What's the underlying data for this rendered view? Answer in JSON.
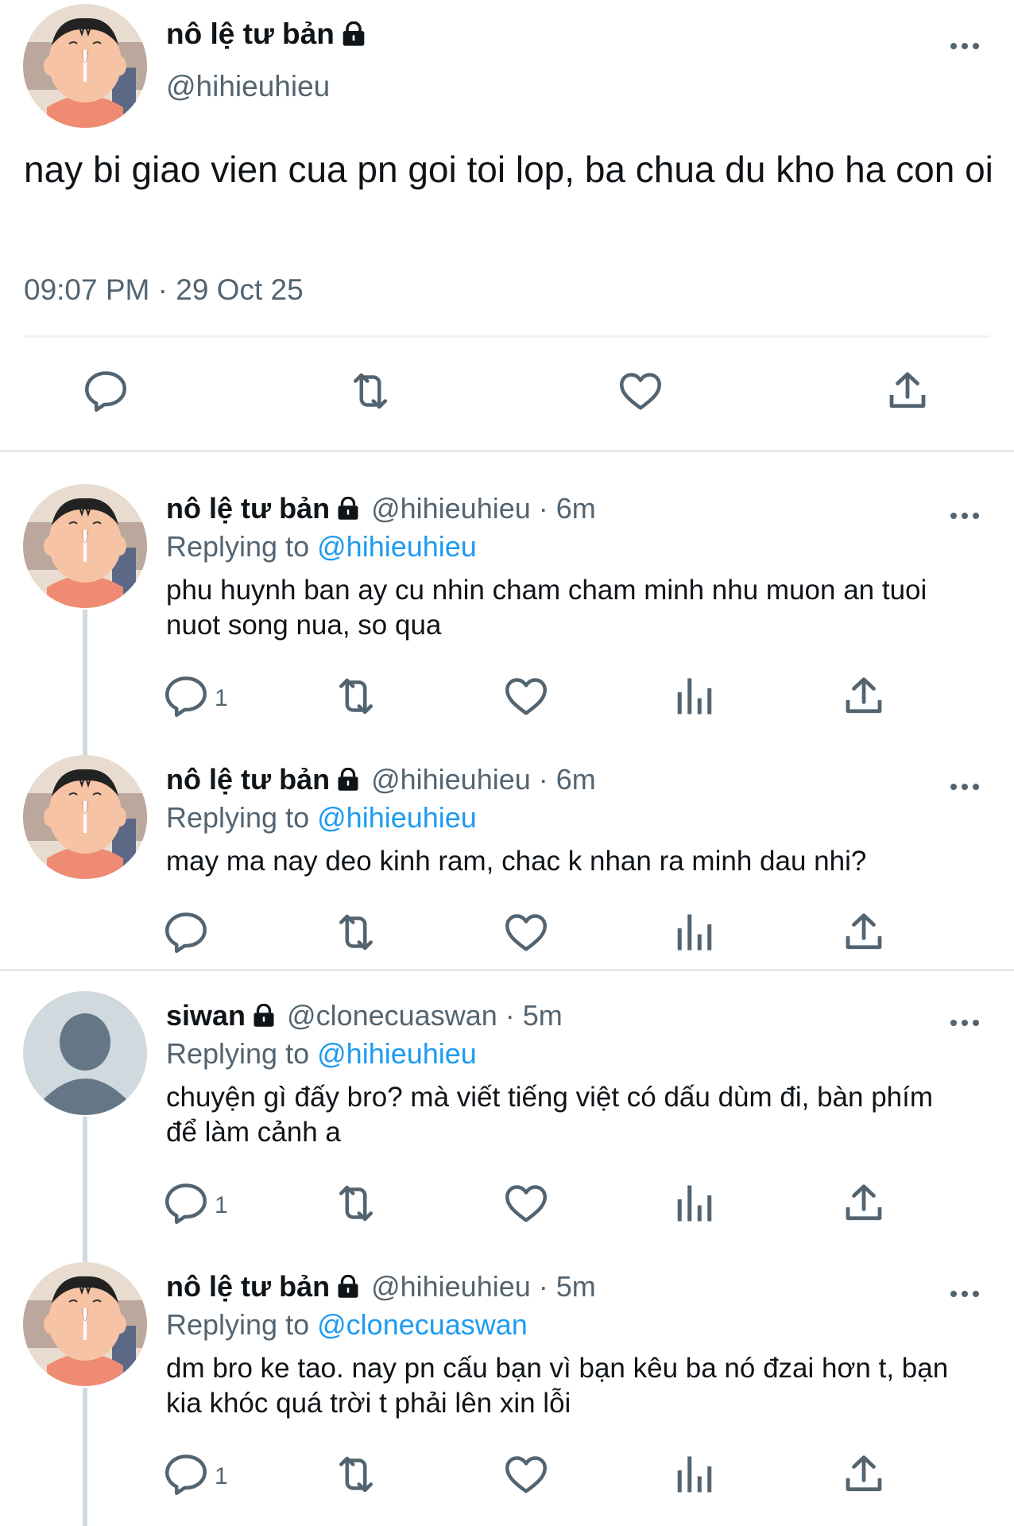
{
  "main": {
    "name": "nô lệ tư bản",
    "handle": "@hihieuhieu",
    "text": "nay bi giao vien cua pn goi toi lop, ba chua du kho ha con oi",
    "timestamp": "09:07 PM · 29 Oct 25"
  },
  "replies": [
    {
      "name": "nô lệ tư bản",
      "meta": "@hihieuhieu · 6m",
      "replying_prefix": "Replying to",
      "replying_to": "@hihieuhieu",
      "text": "phu huynh ban ay cu nhin cham cham minh nhu muon an tuoi nuot song nua, so qua",
      "reply_count": "1",
      "avatar": "cartoon"
    },
    {
      "name": "nô lệ tư bản",
      "meta": "@hihieuhieu · 6m",
      "replying_prefix": "Replying to",
      "replying_to": "@hihieuhieu",
      "text": "may ma nay deo kinh ram, chac k nhan ra minh dau nhi?",
      "reply_count": "",
      "avatar": "cartoon"
    },
    {
      "name": "siwan",
      "meta": "@clonecuaswan · 5m",
      "replying_prefix": "Replying to",
      "replying_to": "@hihieuhieu",
      "text": "chuyện gì đấy bro? mà viết tiếng việt có dấu dùm đi, bàn phím để làm cảnh a",
      "reply_count": "1",
      "avatar": "default"
    },
    {
      "name": "nô lệ tư bản",
      "meta": "@hihieuhieu · 5m",
      "replying_prefix": "Replying to",
      "replying_to": "@clonecuaswan",
      "text": "dm bro ke tao. nay pn cấu bạn vì bạn kêu ba nó đzai hơn t, bạn kia khóc quá trời t phải lên xin lỗi",
      "reply_count": "1",
      "avatar": "cartoon"
    }
  ],
  "icons": {
    "reply": "reply-icon",
    "retweet": "retweet-icon",
    "like": "heart-icon",
    "views": "views-icon",
    "share": "share-icon",
    "lock": "lock-icon",
    "more": "more-icon"
  },
  "colors": {
    "text": "#0f1419",
    "secondary": "#536471",
    "link": "#1d9bf0",
    "divider": "#e6e9ea"
  }
}
